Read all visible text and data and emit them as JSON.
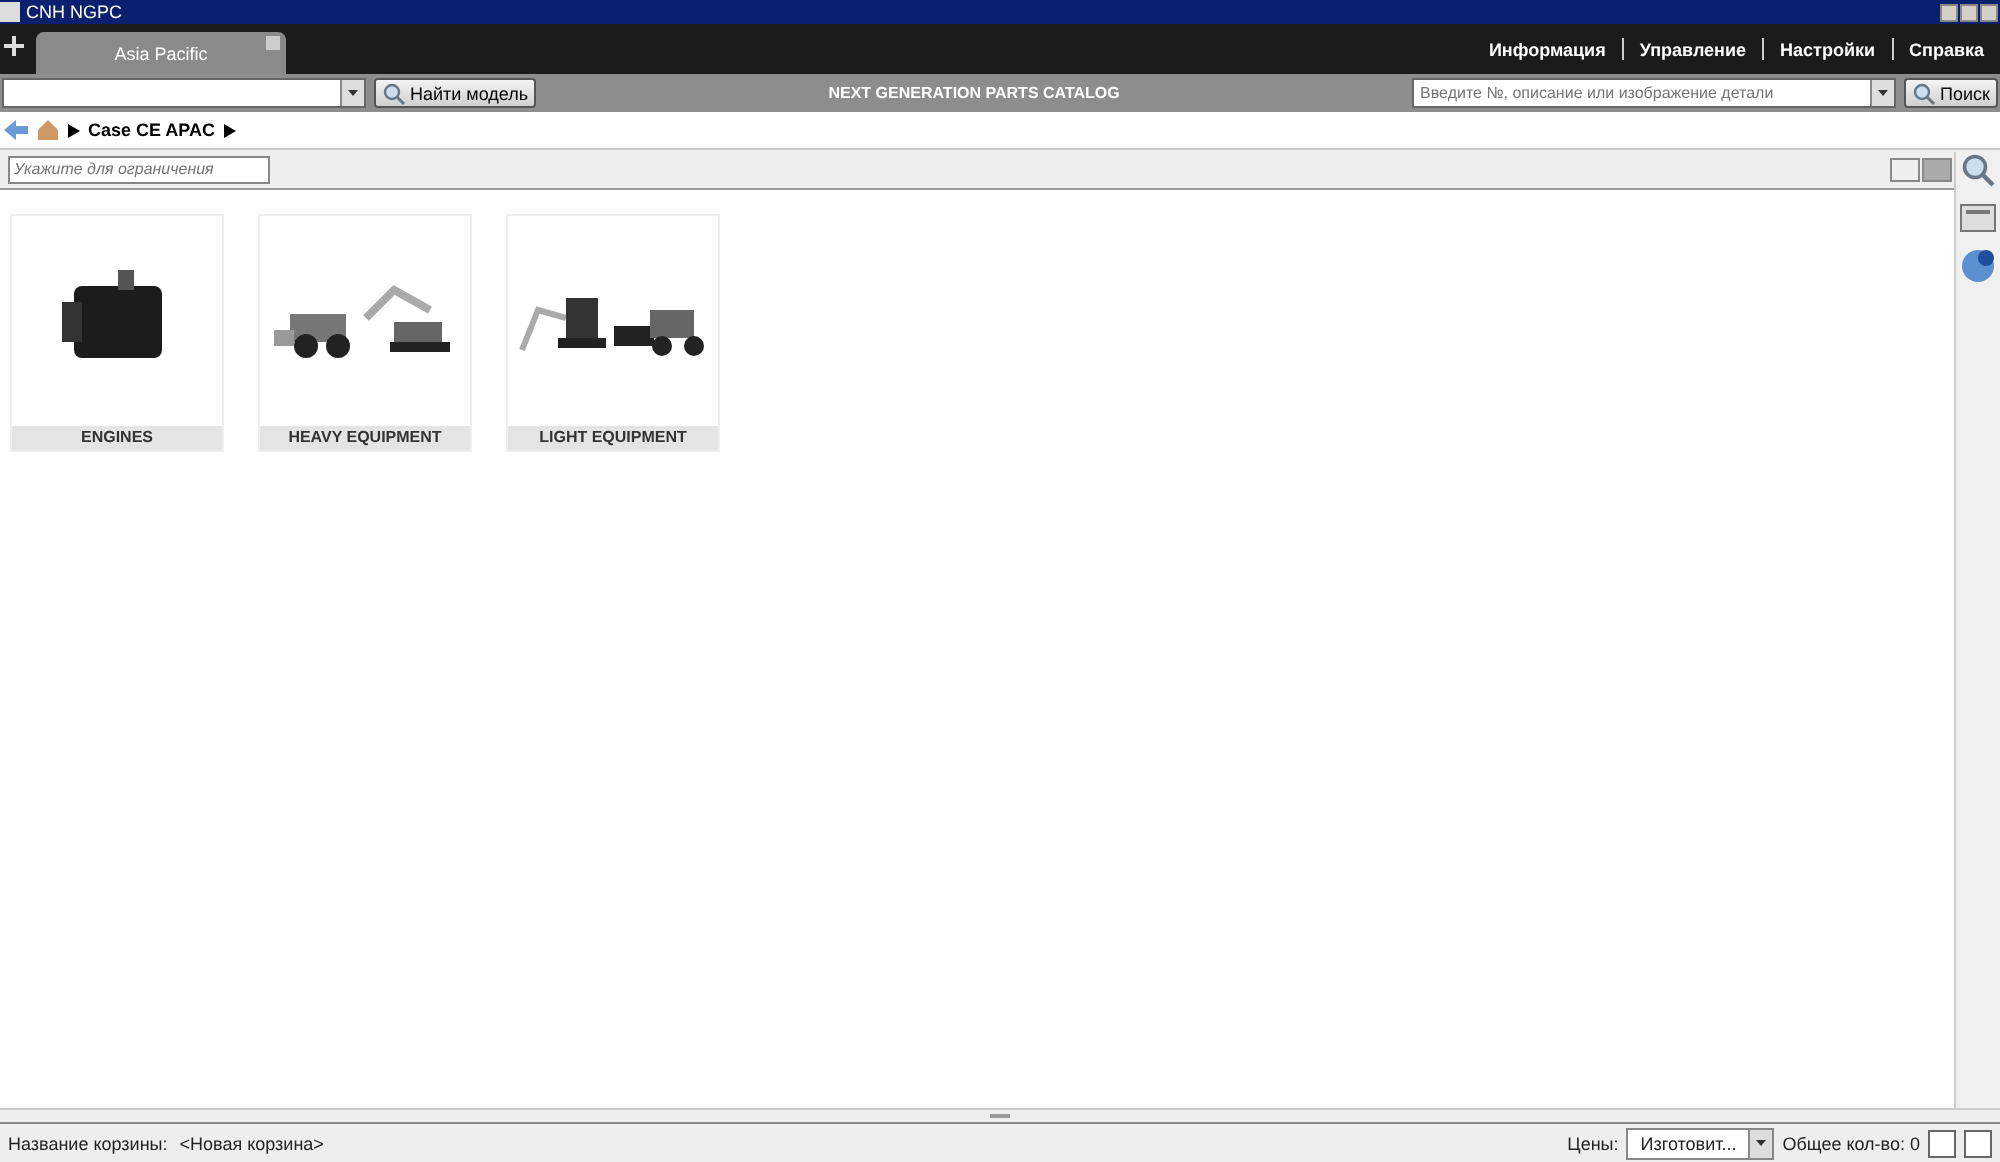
{
  "window": {
    "title": "CNH NGPC"
  },
  "tabs": [
    {
      "label": "Asia Pacific",
      "selected": true
    }
  ],
  "menu": [
    "Информация",
    "Управление",
    "Настройки",
    "Справка"
  ],
  "toolbar": {
    "find_model_button": "Найти модель",
    "title": "NEXT GENERATION PARTS CATALOG",
    "search": {
      "placeholder": "Введите №, описание или изображение детали"
    },
    "search_button": "Поиск"
  },
  "breadcrumb": {
    "items": [
      "Case CE APAC"
    ]
  },
  "filter": {
    "placeholder": "Укажите для ограничения"
  },
  "view_toggle": [
    {
      "selected": false
    },
    {
      "selected": true
    }
  ],
  "categories": [
    {
      "kind": "engine",
      "label": "ENGINES"
    },
    {
      "kind": "heavy",
      "label": "HEAVY EQUIPMENT"
    },
    {
      "kind": "light",
      "label": "LIGHT EQUIPMENT"
    }
  ],
  "status_bar": {
    "cart_label": "Название корзины:",
    "cart_name": "<Новая корзина>",
    "prices_label": "Цены:",
    "prices_value": "Изготовит...",
    "total": "Общее кол-во: 0"
  }
}
